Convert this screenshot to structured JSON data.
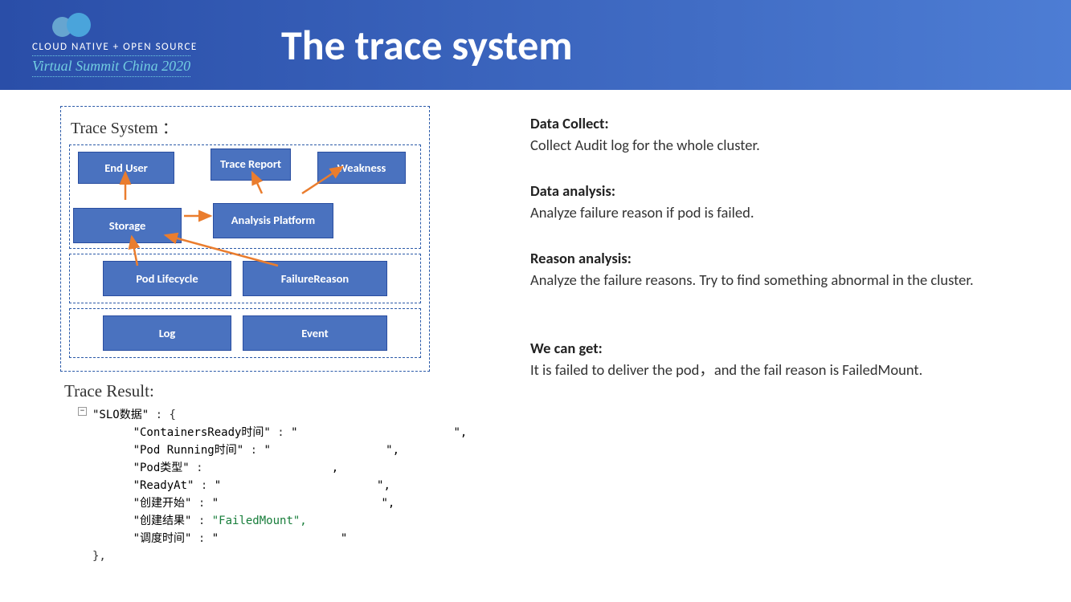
{
  "header": {
    "logo_line1": "CLOUD NATIVE + OPEN SOURCE",
    "logo_line2": "Virtual Summit China 2020",
    "title": "The trace system"
  },
  "diagram": {
    "title": "Trace System ：",
    "boxes": {
      "end_user": "End User",
      "trace_report": "Trace Report",
      "weakness": "Weakness",
      "storage": "Storage",
      "analysis_platform": "Analysis Platform",
      "pod_lifecycle": "Pod Lifecycle",
      "failure_reason": "FailureReason",
      "log": "Log",
      "event": "Event"
    }
  },
  "trace_result": {
    "title": "Trace Result:",
    "root_key": "\"SLO数据\"",
    "fields": [
      {
        "key": "\"ContainersReady时间\"",
        "value": "\"                       \",",
        "green": false
      },
      {
        "key": "\"Pod Running时间\"",
        "value": "\"                 \",",
        "green": false
      },
      {
        "key": "\"Pod类型\"",
        "value": "                  ,",
        "green": false
      },
      {
        "key": "\"ReadyAt\"",
        "value": "\"                       \",",
        "green": false
      },
      {
        "key": "\"创建开始\"",
        "value": "\"                        \",",
        "green": false
      },
      {
        "key": "\"创建结果\"",
        "value": "\"FailedMount\",",
        "green": true
      },
      {
        "key": "\"调度时间\"",
        "value": "\"                  \"",
        "green": false
      }
    ],
    "close": "},"
  },
  "sections": [
    {
      "title": "Data Collect:",
      "body": "Collect Audit log for the whole cluster."
    },
    {
      "title": "Data analysis:",
      "body": "Analyze failure reason if pod is failed."
    },
    {
      "title": "Reason analysis:",
      "body": "Analyze the failure reasons. Try to find something abnormal in the cluster."
    },
    {
      "title": "We can get:",
      "body": "It is failed to deliver the pod，and the fail reason is FailedMount."
    }
  ]
}
